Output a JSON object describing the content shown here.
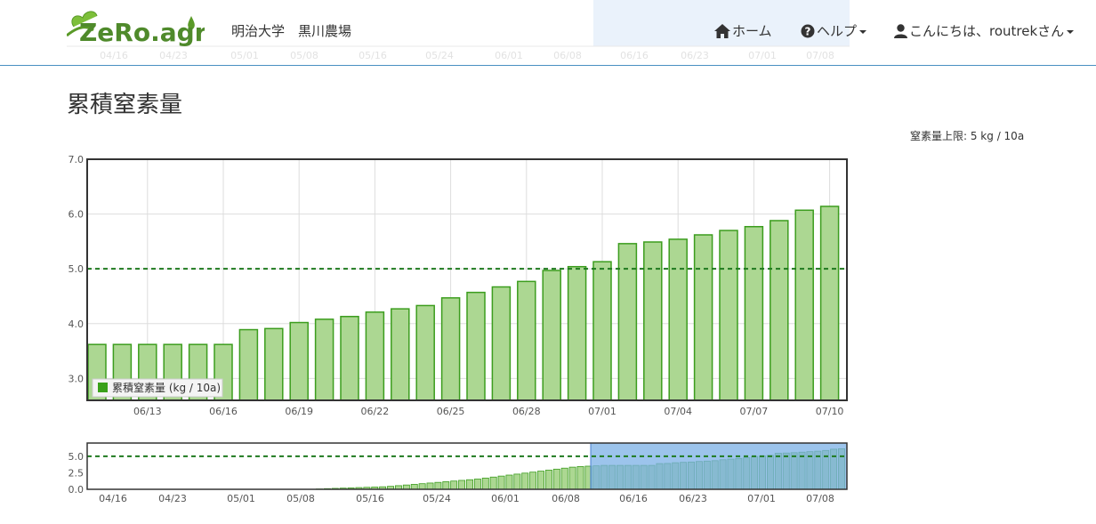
{
  "header": {
    "logo_text": "ZeRo.agri",
    "farm_name": "明治大学　黒川農場",
    "home_label": "ホーム",
    "help_label": "ヘルプ",
    "user_label": "こんにちは、routrekさん"
  },
  "page": {
    "title": "累積窒素量",
    "limit_label": "窒素量上限: 5 kg / 10a"
  },
  "colors": {
    "bar_fill": "#acd792",
    "bar_stroke": "#3c9d1e",
    "threshold": "#1f7a1f",
    "selection": "#7bb0e6",
    "nav_border": "#4a90c2"
  },
  "chart_data": [
    {
      "type": "bar",
      "legend": "累積窒素量 (kg / 10a)",
      "legend_position": "bottom-left",
      "x_tick_labels": [
        "06/13",
        "06/16",
        "06/19",
        "06/22",
        "06/25",
        "06/28",
        "07/01",
        "07/04",
        "07/07",
        "07/10"
      ],
      "categories": [
        "06/11",
        "06/12",
        "06/13",
        "06/14",
        "06/15",
        "06/16",
        "06/17",
        "06/18",
        "06/19",
        "06/20",
        "06/21",
        "06/22",
        "06/23",
        "06/24",
        "06/25",
        "06/26",
        "06/27",
        "06/28",
        "06/29",
        "06/30",
        "07/01",
        "07/02",
        "07/03",
        "07/04",
        "07/05",
        "07/06",
        "07/07",
        "07/08",
        "07/09",
        "07/10"
      ],
      "values": [
        3.62,
        3.62,
        3.62,
        3.62,
        3.62,
        3.62,
        3.89,
        3.91,
        4.02,
        4.08,
        4.13,
        4.21,
        4.27,
        4.33,
        4.47,
        4.57,
        4.67,
        4.77,
        4.97,
        5.04,
        5.13,
        5.46,
        5.49,
        5.54,
        5.62,
        5.7,
        5.77,
        5.88,
        6.07,
        6.14
      ],
      "y_ticks": [
        "3.0",
        "4.0",
        "5.0",
        "6.0",
        "7.0"
      ],
      "ylim": [
        2.6,
        7.0
      ],
      "threshold": 5.0,
      "grid": true
    },
    {
      "type": "bar",
      "role": "overview navigator",
      "x_tick_labels": [
        "04/16",
        "04/23",
        "05/01",
        "05/08",
        "05/16",
        "05/24",
        "06/01",
        "06/08",
        "06/16",
        "06/23",
        "07/01",
        "07/08"
      ],
      "y_ticks": [
        "0.0",
        "2.5",
        "5.0"
      ],
      "ylim": [
        0,
        7
      ],
      "threshold": 5.0,
      "selection": [
        "06/11",
        "07/10"
      ],
      "values": [
        0.05,
        0.1,
        0.14,
        0.18,
        0.22,
        0.26,
        0.3,
        0.34,
        0.38,
        0.45,
        0.55,
        0.65,
        0.75,
        0.85,
        0.95,
        1.05,
        1.15,
        1.25,
        1.35,
        1.45,
        1.55,
        1.7,
        1.85,
        2.0,
        2.15,
        2.3,
        2.45,
        2.6,
        2.75,
        2.9,
        3.05,
        3.2,
        3.35,
        3.45,
        3.5,
        3.55,
        3.62,
        3.62,
        3.62,
        3.62,
        3.62,
        3.62,
        3.62,
        3.89,
        3.91,
        4.02,
        4.08,
        4.13,
        4.21,
        4.27,
        4.33,
        4.47,
        4.57,
        4.67,
        4.77,
        4.97,
        5.04,
        5.13,
        5.46,
        5.49,
        5.54,
        5.62,
        5.7,
        5.77,
        5.88,
        6.07,
        6.14
      ]
    }
  ]
}
